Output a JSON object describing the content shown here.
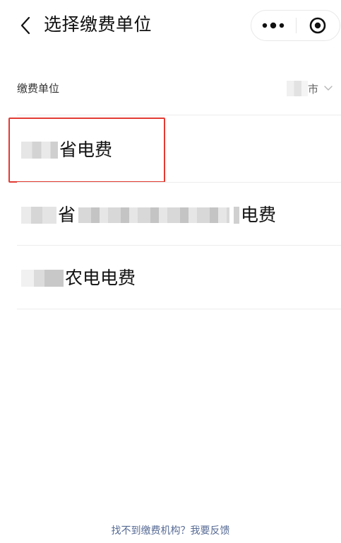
{
  "header": {
    "title": "选择缴费单位",
    "back_icon": "chevron-left-icon",
    "more_icon": "more-dots-icon",
    "close_icon": "target-circle-icon"
  },
  "unit_selector": {
    "label": "缴费单位",
    "city_value": "市",
    "dropdown_icon": "chevron-down-icon"
  },
  "list": {
    "items": [
      {
        "suffix": "省电费"
      },
      {
        "prefix": "省",
        "suffix": "电费"
      },
      {
        "suffix": "农电电费"
      }
    ]
  },
  "footer": {
    "feedback_link": "找不到缴费机构？我要反馈"
  },
  "colors": {
    "highlight_border": "#e23b33",
    "link": "#576b95",
    "separator": "#ececec"
  }
}
